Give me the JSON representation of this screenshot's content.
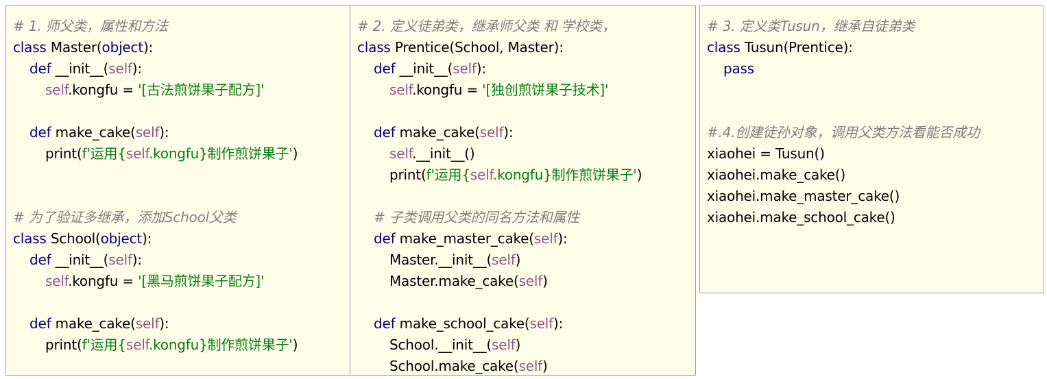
{
  "panel1": {
    "comment1": "# 1. 师父类，属性和方法",
    "class_kw": "class",
    "class_name": " Master(",
    "base": "object",
    "close": "):",
    "def_kw": "def",
    "init": " __init__(",
    "self": "self",
    "close2": "):",
    "attr_pre": ".kongfu = ",
    "str1": "'[古法煎饼果子配方]'",
    "make_cake": " make_cake(",
    "print_pre": "print(",
    "fstr_a": "f'运用{",
    "fstr_b": ".kongfu}制作煎饼果子'",
    "print_post": ")",
    "comment2": "# 为了验证多继承，添加School父类",
    "class2_name": " School(",
    "str2": "'[黑马煎饼果子配方]'"
  },
  "panel2": {
    "comment1": "# 2. 定义徒弟类，继承师父类 和 学校类，",
    "class_name": " Prentice(School, Master):",
    "str1": "'[独创煎饼果子技术]'",
    "init_call": ".__init__()",
    "comment2": "# 子类调用父类的同名方法和属性",
    "make_master": " make_master_cake(",
    "master_init": "Master.__init__(",
    "master_make": "Master.make_cake(",
    "make_school": " make_school_cake(",
    "school_init": "School.__init__(",
    "school_make": "School.make_cake("
  },
  "panel3": {
    "comment1": "# 3. 定义类Tusun，继承自徒弟类",
    "class_name": " Tusun(Prentice):",
    "pass_kw": "pass",
    "comment2": "#.4.创建徒孙对象，调用父类方法看能否成功",
    "line1": "xiaohei = Tusun()",
    "line2": "xiaohei.make_cake()",
    "line3": "xiaohei.make_master_cake()",
    "line4": "xiaohei.make_school_cake()"
  },
  "colors": {
    "panel_bg": "#fefde8",
    "keyword": "#000080",
    "self": "#94558d",
    "string": "#067d17",
    "comment": "#808080"
  }
}
